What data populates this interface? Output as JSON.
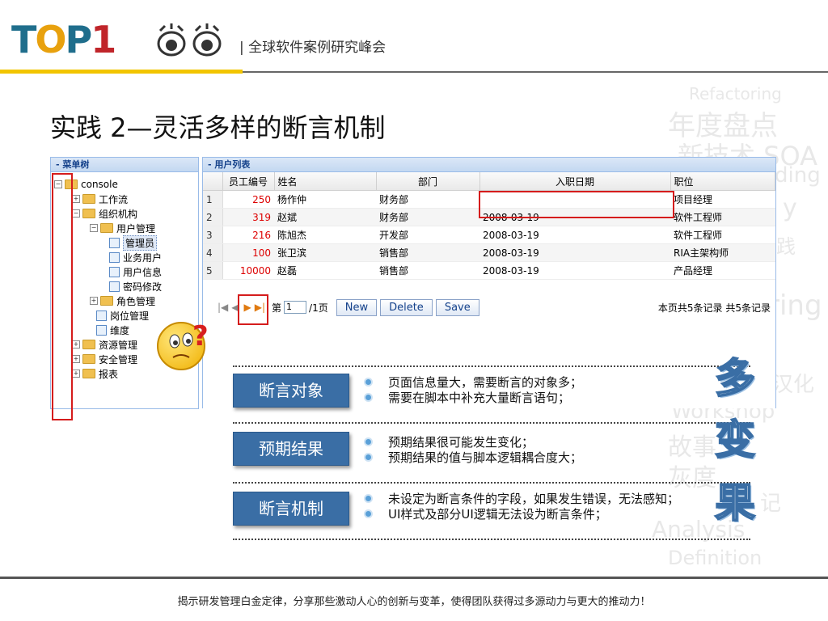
{
  "header": {
    "logo": {
      "t": "T",
      "o": "O",
      "p": "P",
      "one": "1"
    },
    "subtitle": "| 全球软件案例研究峰会"
  },
  "slide_title": "实践 2—灵活多样的断言机制",
  "watermark": [
    "Refactoring",
    "年度盘点",
    "新技术 SOA",
    "ding",
    "y",
    "践",
    "ring",
    "汉化",
    "Workshop",
    "故事",
    "灰度",
    "记",
    "Analysis",
    "Definition"
  ],
  "tree": {
    "title": "- 菜单树",
    "nodes": [
      {
        "label": "console"
      },
      {
        "label": "工作流"
      },
      {
        "label": "组织机构"
      },
      {
        "label": "用户管理"
      },
      {
        "label": "管理员"
      },
      {
        "label": "业务用户"
      },
      {
        "label": "用户信息"
      },
      {
        "label": "密码修改"
      },
      {
        "label": "角色管理"
      },
      {
        "label": "岗位管理"
      },
      {
        "label": "维度"
      },
      {
        "label": "资源管理"
      },
      {
        "label": "安全管理"
      },
      {
        "label": "报表"
      }
    ]
  },
  "grid": {
    "title": "- 用户列表",
    "columns": [
      "员工编号",
      "姓名",
      "部门",
      "入职日期",
      "职位"
    ],
    "rows": [
      {
        "n": "1",
        "id": "250",
        "name": "杨作仲",
        "dept": "财务部",
        "date": "",
        "pos": "项目经理"
      },
      {
        "n": "2",
        "id": "319",
        "name": "赵斌",
        "dept": "财务部",
        "date": "2008-03-19",
        "pos": "软件工程师"
      },
      {
        "n": "3",
        "id": "216",
        "name": "陈旭杰",
        "dept": "开发部",
        "date": "2008-03-19",
        "pos": "软件工程师"
      },
      {
        "n": "4",
        "id": "100",
        "name": "张卫滨",
        "dept": "销售部",
        "date": "2008-03-19",
        "pos": "RIA主架构师"
      },
      {
        "n": "5",
        "id": "10000",
        "name": "赵磊",
        "dept": "销售部",
        "date": "2008-03-19",
        "pos": "产品经理"
      }
    ],
    "pager": {
      "first": "|◀",
      "prev": "◀",
      "next": "▶",
      "last": "▶|",
      "page_label": "第",
      "page_value": "1",
      "page_total": "/1页",
      "new": "New",
      "delete": "Delete",
      "save": "Save",
      "summary": "本页共5条记录 共5条记录"
    }
  },
  "info": [
    {
      "label": "断言对象",
      "points": [
        "页面信息量大，需要断言的对象多；",
        "需要在脚本中补充大量断言语句；"
      ]
    },
    {
      "label": "预期结果",
      "points": [
        "预期结果很可能发生变化；",
        "预期结果的值与脚本逻辑耦合度大；"
      ]
    },
    {
      "label": "断言机制",
      "points": [
        "未设定为断言条件的字段，如果发生错误，无法感知；",
        "UI样式及部分UI逻辑无法设为断言条件；"
      ]
    }
  ],
  "side_chars": [
    "多",
    "变",
    "果"
  ],
  "emoji_mark": "?",
  "footer": "揭示研发管理白金定律，分享那些激动人心的创新与变革，使得团队获得过多源动力与更大的推动力！",
  "colors": {
    "accent_blue": "#3a6ea5",
    "red_box": "#d51c1c",
    "logo_yellow": "#e8a10e"
  }
}
